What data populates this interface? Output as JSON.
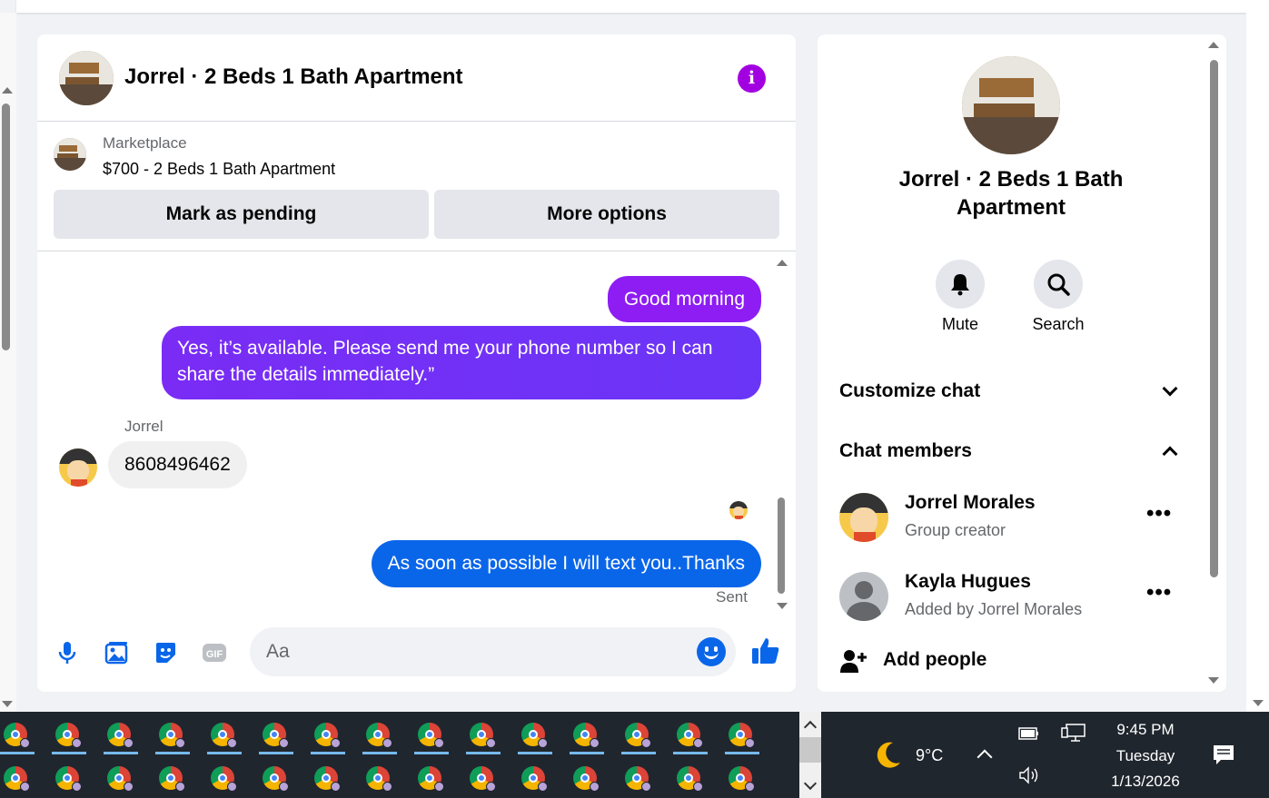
{
  "chat": {
    "title": "Jorrel · 2 Beds 1 Bath Apartment",
    "marketplace_label": "Marketplace",
    "listing": "$700 - 2 Beds 1 Bath Apartment",
    "mark_pending": "Mark as pending",
    "more_options": "More options",
    "messages": [
      {
        "from": "me",
        "text": "Good morning"
      },
      {
        "from": "me",
        "text": "Yes, it’s available. Please send me your phone number so I can share the details immediately.”"
      },
      {
        "from": "Jorrel",
        "sender_label": "Jorrel",
        "text": "8608496462"
      },
      {
        "from": "me",
        "text": "As soon as possible I will text you..Thanks"
      }
    ],
    "status": "Sent",
    "composer_placeholder": "Aa"
  },
  "panel": {
    "title": "Jorrel · 2 Beds 1 Bath Apartment",
    "mute": "Mute",
    "search": "Search",
    "customize": "Customize chat",
    "members_header": "Chat members",
    "members": [
      {
        "name": "Jorrel Morales",
        "sub": "Group creator"
      },
      {
        "name": "Kayla Hugues",
        "sub": "Added by Jorrel Morales"
      }
    ],
    "add_people": "Add people"
  },
  "taskbar": {
    "weather": "9°C",
    "time": "9:45 PM",
    "day": "Tuesday",
    "date": "1/13/2026"
  },
  "colors": {
    "accent_purple": "#8d1df2",
    "accent_blue": "#0a66e9",
    "info_icon": "#a200e0"
  }
}
